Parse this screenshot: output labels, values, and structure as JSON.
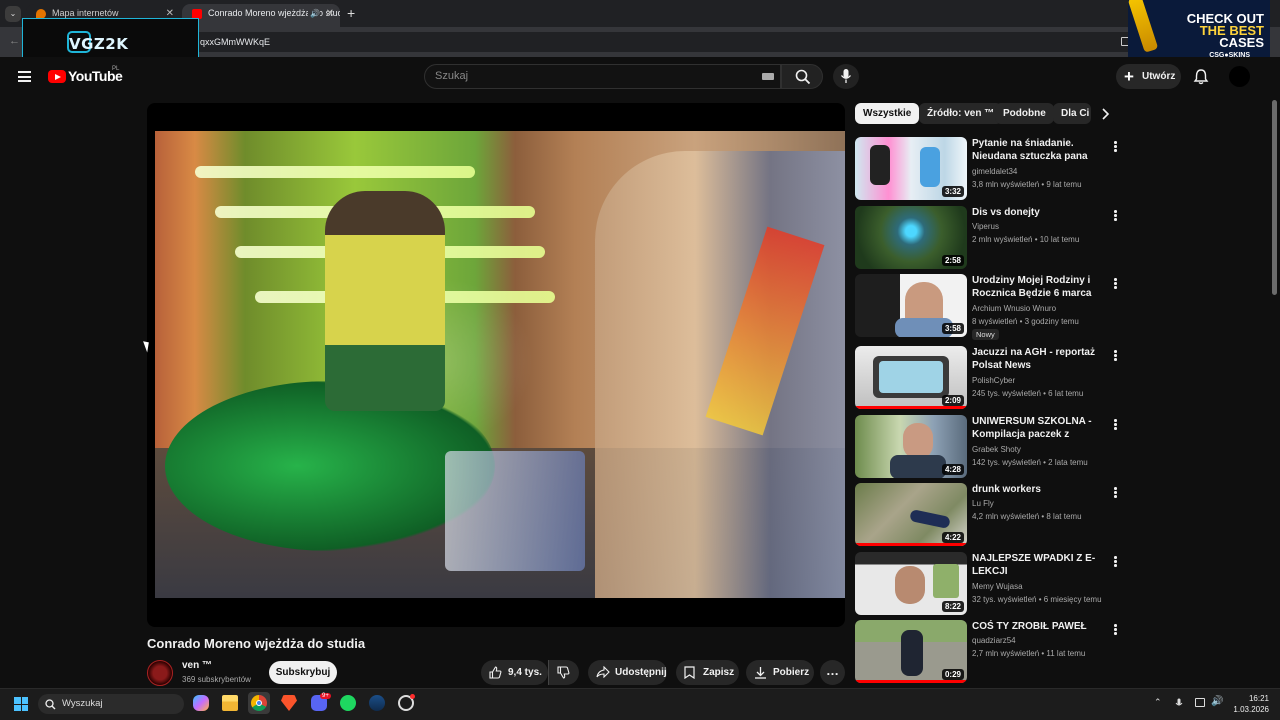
{
  "browser": {
    "tabs": [
      {
        "title": "Mapa internetów",
        "active": false
      },
      {
        "title": "Conrado Moreno wjeżdża do studia",
        "active": true
      }
    ],
    "url": "qxxGMmWWKqE"
  },
  "overlay": {
    "logo_text": "VGZ2K"
  },
  "ad": {
    "line1": "CHECK OUT",
    "line2": "THE BEST",
    "line3": "CASES",
    "brand": "CSG●SKINS"
  },
  "header": {
    "logo_text": "YouTube",
    "country": "PL",
    "search_placeholder": "Szukaj",
    "create_label": "Utwórz"
  },
  "video": {
    "title": "Conrado Moreno wjeżdża do studia",
    "channel": "ven ™",
    "subscribers": "369 subskrybentów",
    "subscribe_label": "Subskrybuj",
    "likes": "9,4 tys.",
    "share_label": "Udostępnij",
    "save_label": "Zapisz",
    "download_label": "Pobierz"
  },
  "chips": [
    "Wszystkie",
    "Źródło: ven ™",
    "Podobne",
    "Dla Ci"
  ],
  "recommendations": [
    {
      "title": "Pytanie na śniadanie. Nieudana sztuczka pana Ząbka. Przebita...",
      "channel": "gimeldalet34",
      "meta": "3,8 mln wyświetleń • 9 lat temu",
      "duration": "3:32",
      "badge": "",
      "progress": 0
    },
    {
      "title": "Dis vs donejty",
      "channel": "Viperus",
      "meta": "2 mln wyświetleń • 10 lat temu",
      "duration": "2:58",
      "badge": "",
      "progress": 0
    },
    {
      "title": "Urodziny Mojej Rodziny i Rocznica Będzie 6 marca",
      "channel": "Archium Wnusio Wnuro",
      "meta": "8 wyświetleń • 3 godziny temu",
      "duration": "3:58",
      "badge": "Nowy",
      "progress": 0
    },
    {
      "title": "Jacuzzi na AGH - reportaż Polsat News",
      "channel": "PolishCyber",
      "meta": "245 tys. wyświetleń • 6 lat temu",
      "duration": "2:09",
      "badge": "",
      "progress": 1
    },
    {
      "title": "UNIWERSUM SZKOLNA - Kompilacja paczek z gównem ...",
      "channel": "Grabek Shoty",
      "meta": "142 tys. wyświetleń • 2 lata temu",
      "duration": "4:28",
      "badge": "",
      "progress": 0
    },
    {
      "title": "drunk workers",
      "channel": "Lu Fly",
      "meta": "4,2 mln wyświetleń • 8 lat temu",
      "duration": "4:22",
      "badge": "",
      "progress": 1
    },
    {
      "title": "NAJLEPSZE WPADKI Z E-LEKCJI",
      "channel": "Memy Wujasa",
      "meta": "32 tys. wyświetleń • 6 miesięcy temu",
      "duration": "8:22",
      "badge": "",
      "progress": 0
    },
    {
      "title": "COŚ TY ZROBIŁ PAWEŁ",
      "channel": "quadziarz54",
      "meta": "2,7 mln wyświetleń • 11 lat temu",
      "duration": "0:29",
      "badge": "",
      "progress": 1
    }
  ],
  "taskbar": {
    "search_placeholder": "Wyszukaj",
    "time": "16:21",
    "date": "1.03.2026",
    "discord_badge": "9+"
  }
}
